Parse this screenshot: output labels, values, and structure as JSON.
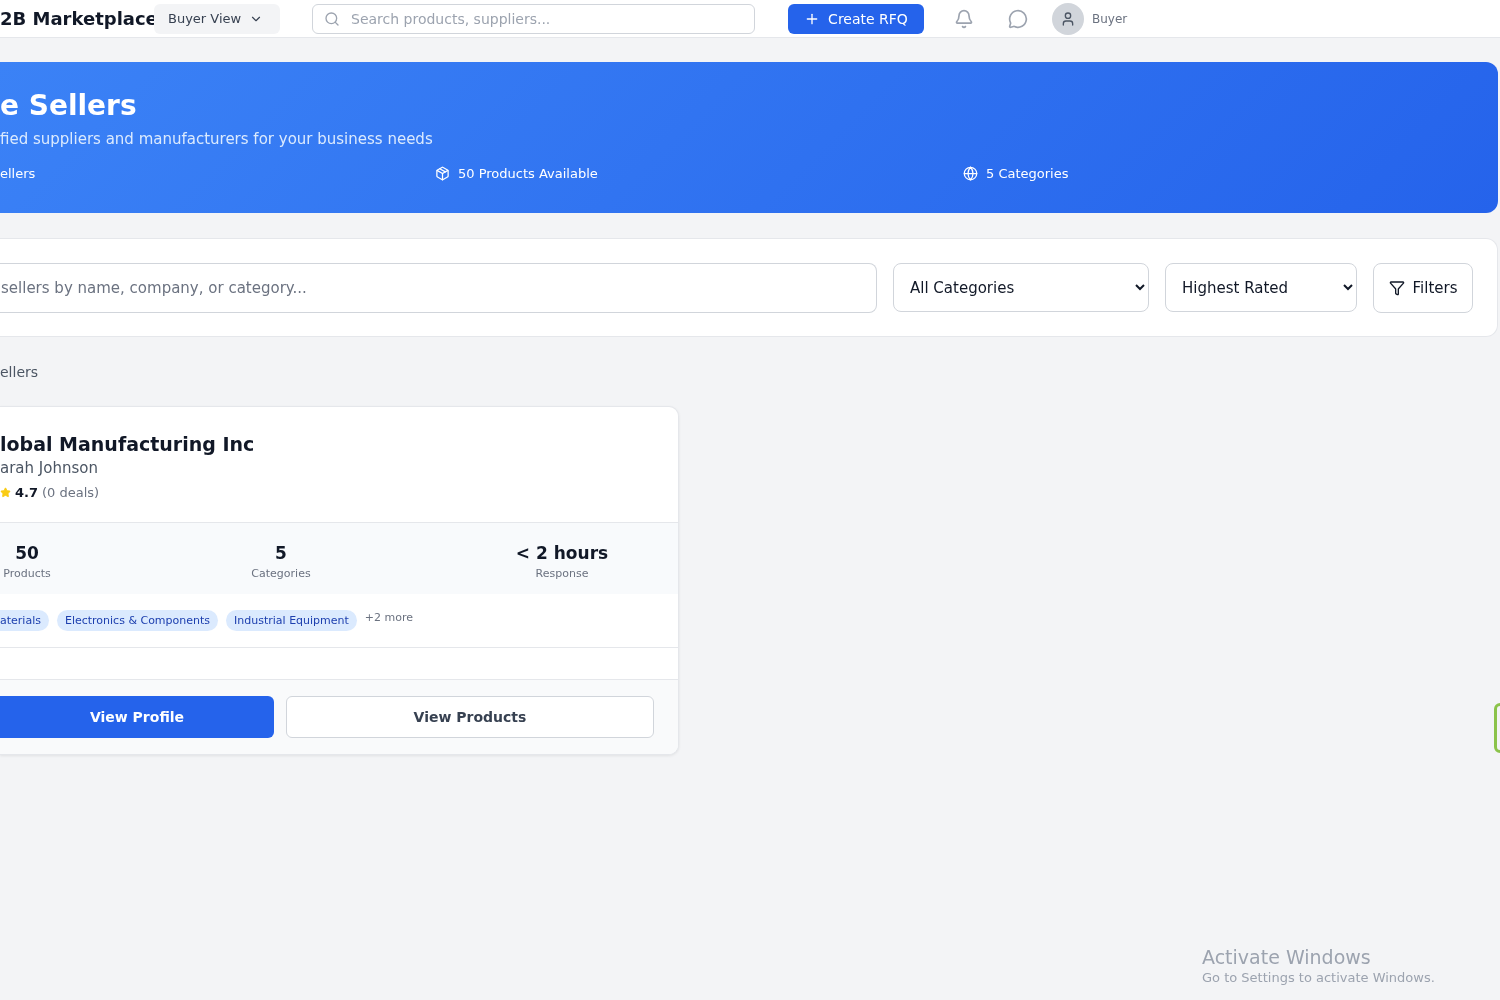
{
  "header": {
    "logo": "2B Marketplace",
    "view_switch": {
      "label": "Buyer View",
      "expanded": false
    },
    "search": {
      "placeholder": "Search products, suppliers..."
    },
    "create_button": "Create RFQ",
    "user": {
      "role": "Buyer"
    }
  },
  "hero": {
    "title": "e Sellers",
    "subtitle": "fied suppliers and manufacturers for your business needs",
    "stats": [
      {
        "kind": "plain",
        "label": "ellers"
      },
      {
        "kind": "package",
        "label": "50 Products Available"
      },
      {
        "kind": "globe",
        "label": "5 Categories"
      }
    ]
  },
  "filters": {
    "search": {
      "placeholder": "sellers by name, company, or category..."
    },
    "selects": [
      {
        "value": "All Categories"
      },
      {
        "value": "Highest Rated"
      }
    ],
    "filters_button": "Filters"
  },
  "results_label": "ellers",
  "sellers": [
    {
      "name": "lobal Manufacturing Inc",
      "contact": "arah Johnson",
      "rating": "4.7",
      "deals": "(0 deals)",
      "stats": [
        {
          "value": "50",
          "label": "Products"
        },
        {
          "value": "5",
          "label": "Categories"
        },
        {
          "value": "< 2 hours",
          "label": "Response"
        }
      ],
      "tags": [
        "aterials",
        "Electronics & Components",
        "Industrial Equipment"
      ],
      "more": "+2 more",
      "actions": [
        {
          "kind": "primary",
          "label": "View Profile"
        },
        {
          "kind": "secondary",
          "label": "View Products"
        }
      ]
    }
  ],
  "os_notice": {
    "title": "Activate Windows",
    "text": "Go to Settings to activate Windows."
  }
}
